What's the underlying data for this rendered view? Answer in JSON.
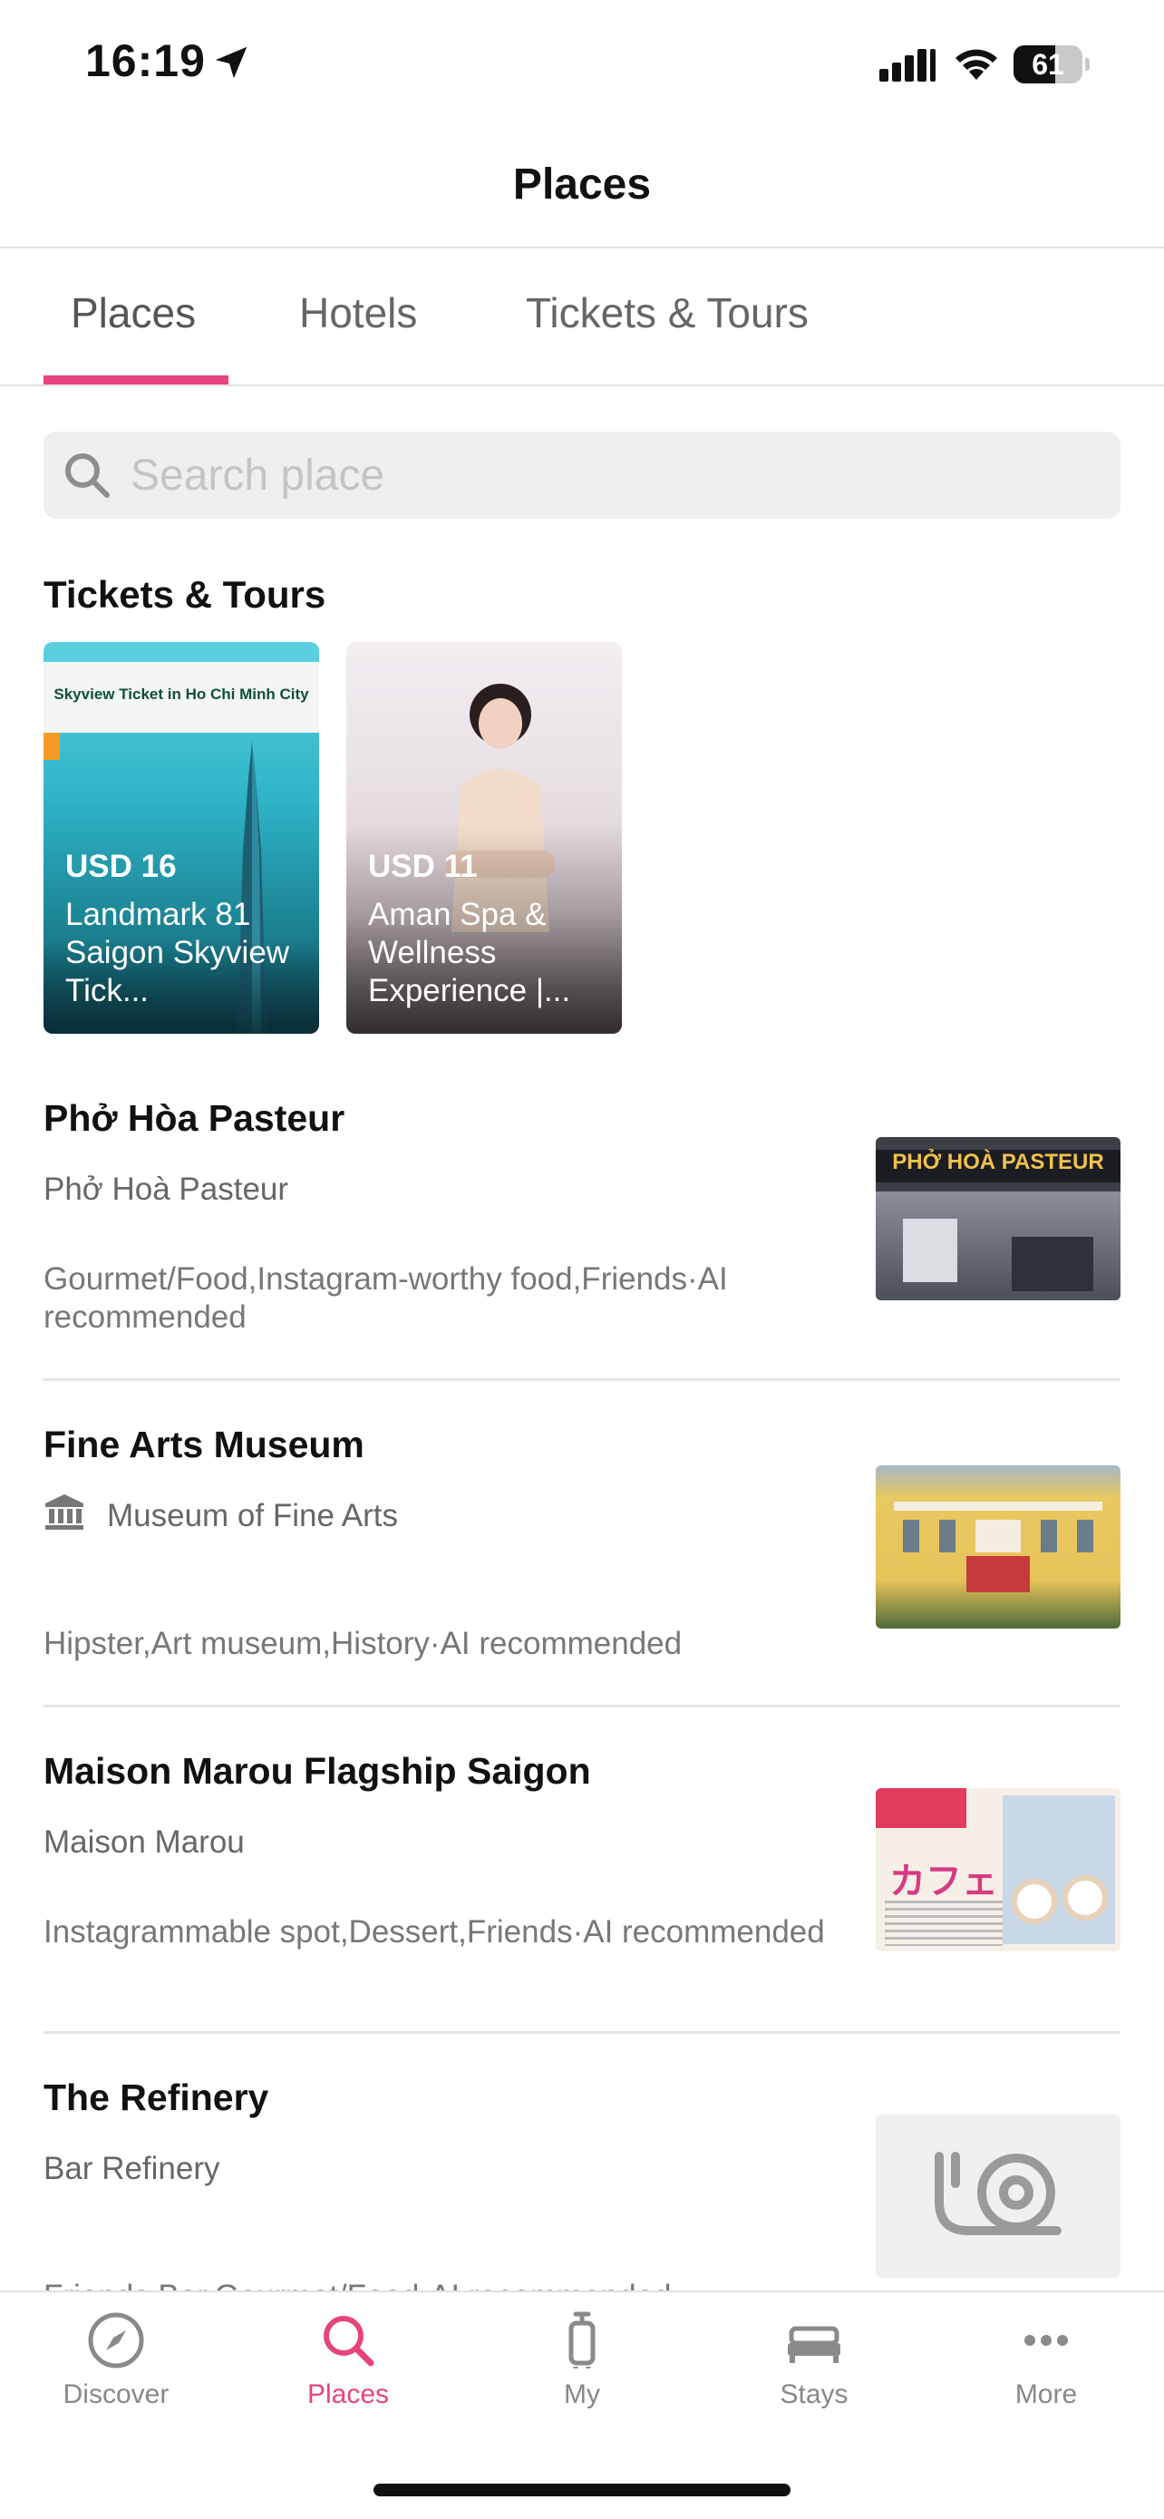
{
  "status_bar": {
    "time": "16:19",
    "battery_percent": 61,
    "battery_label": "61"
  },
  "header": {
    "title": "Places"
  },
  "tabs": [
    {
      "label": "Places",
      "active": true
    },
    {
      "label": "Hotels",
      "active": false
    },
    {
      "label": "Tickets & Tours",
      "active": false
    }
  ],
  "search": {
    "placeholder": "Search place"
  },
  "tickets_section": {
    "title": "Tickets & Tours",
    "cards": [
      {
        "banner": "Skyview Ticket in Ho Chi Minh City",
        "price": "USD 16",
        "name": "Landmark 81 Saigon Skyview Tick..."
      },
      {
        "price": "USD 11",
        "name": "Aman Spa & Wellness Experience |..."
      }
    ]
  },
  "places": [
    {
      "title": "Phở Hòa Pasteur",
      "subtitle": "Phở Hoà Pasteur",
      "tags": "Gourmet/Food,Instagram-worthy food,Friends·AI recommended",
      "thumb_sign": "PHỞ HOÀ PASTEUR"
    },
    {
      "title": "Fine Arts Museum",
      "subtitle": "Museum of Fine Arts",
      "icon": "museum-icon",
      "tags": "Hipster,Art museum,History·AI recommended"
    },
    {
      "title": "Maison Marou Flagship Saigon",
      "subtitle": "Maison Marou",
      "tags": "Instagrammable spot,Dessert,Friends·AI recommended",
      "thumb_sign": "カフェ"
    },
    {
      "title": "The Refinery",
      "subtitle": "Bar Refinery",
      "tags": "Friends,Bar,Gourmet/Food·AI recommended",
      "thumb_icon": "snail-placeholder-icon"
    }
  ],
  "tabbar": [
    {
      "label": "Discover",
      "icon": "compass-icon",
      "active": false
    },
    {
      "label": "Places",
      "icon": "search-icon",
      "active": true
    },
    {
      "label": "My",
      "icon": "luggage-icon",
      "active": false
    },
    {
      "label": "Stays",
      "icon": "bed-icon",
      "active": false
    },
    {
      "label": "More",
      "icon": "more-dots-icon",
      "active": false
    }
  ],
  "colors": {
    "accent": "#e5447f",
    "tab_inactive": "#888888",
    "search_bg": "#efefef"
  }
}
